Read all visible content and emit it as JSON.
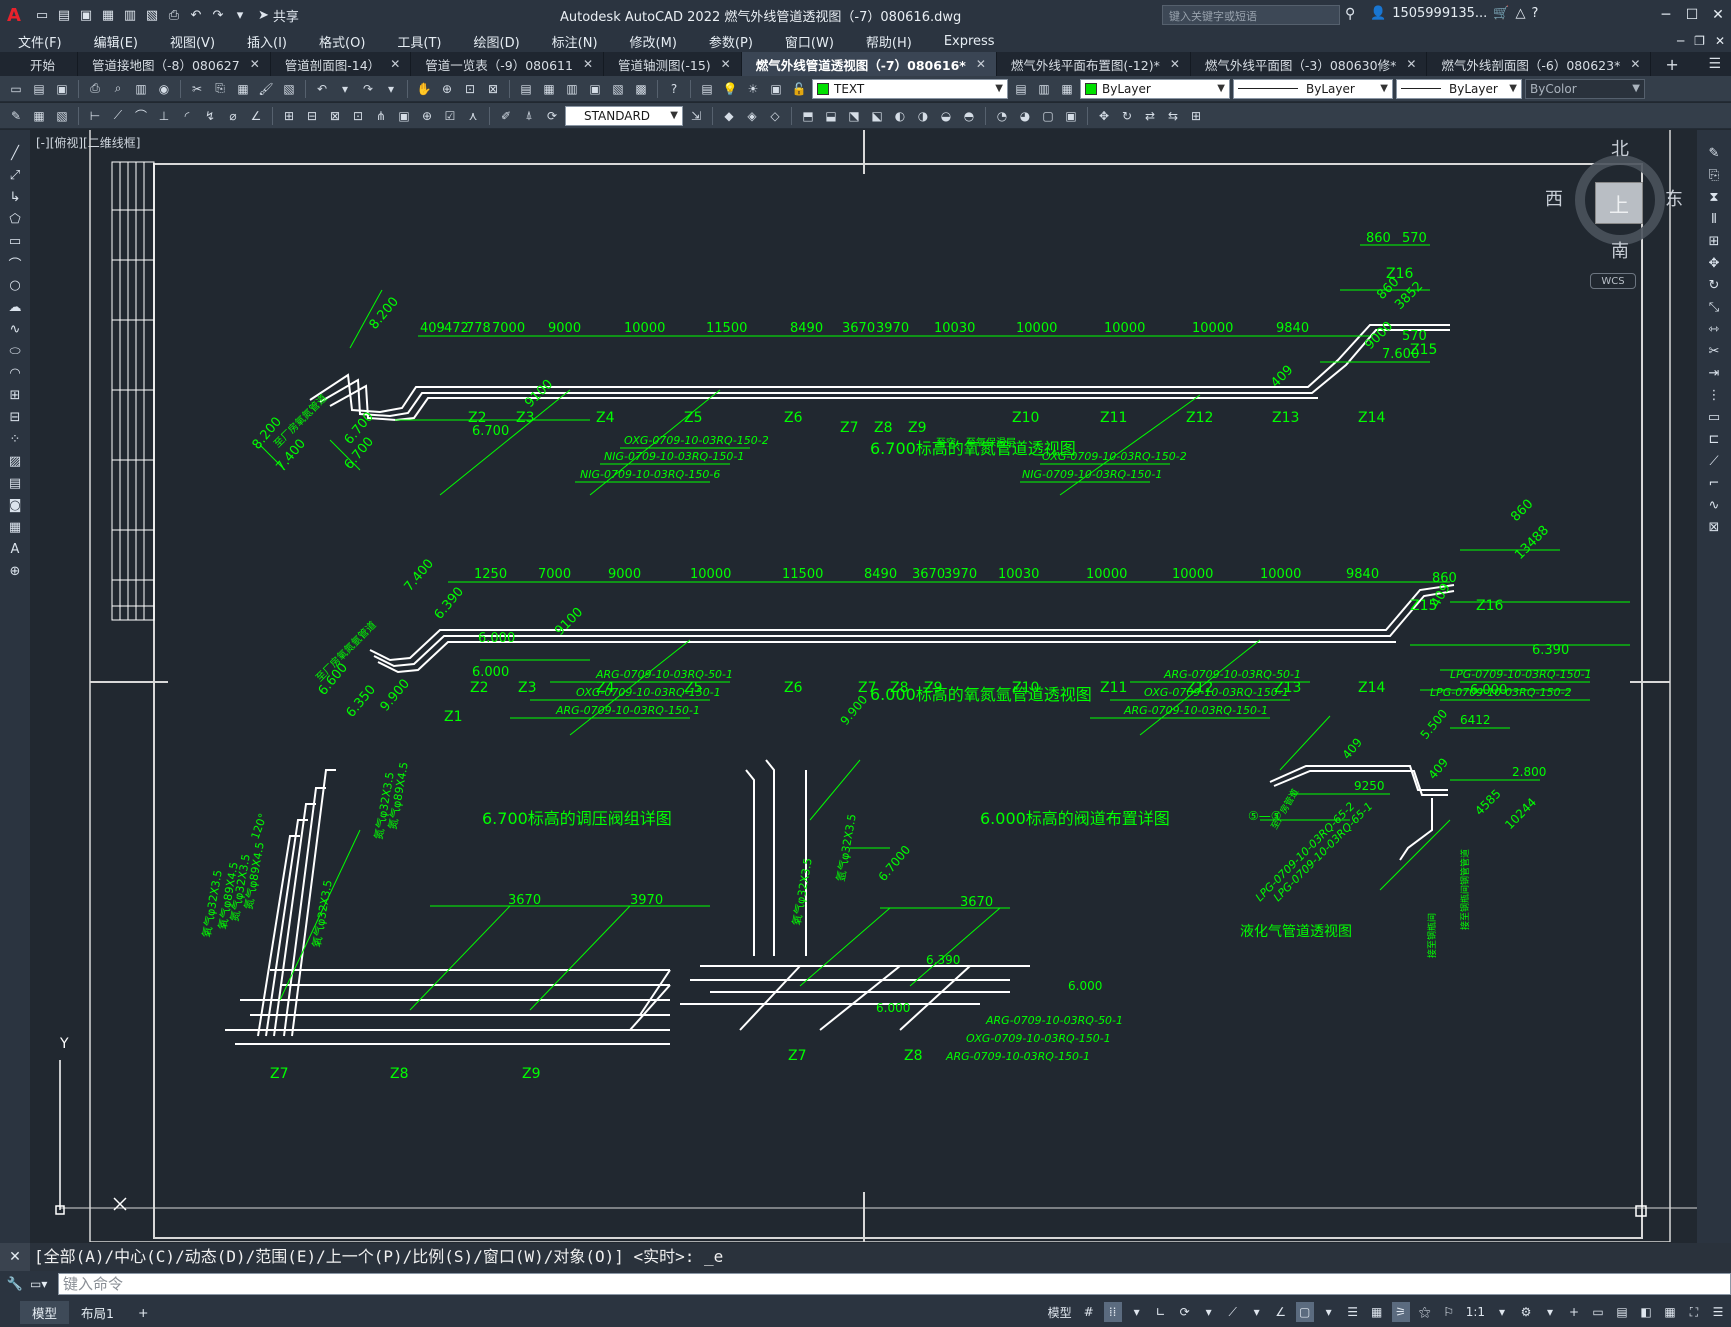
{
  "app": {
    "logo": "A",
    "title": "Autodesk AutoCAD 2022    燃气外线管道透视图（-7）080616.dwg",
    "share_label": "共享",
    "search_placeholder": "键入关键字或短语",
    "user_name": "1505999135...",
    "window_controls": [
      "─",
      "☐",
      "✕"
    ]
  },
  "menu": [
    "文件(F)",
    "编辑(E)",
    "视图(V)",
    "插入(I)",
    "格式(O)",
    "工具(T)",
    "绘图(D)",
    "标注(N)",
    "修改(M)",
    "参数(P)",
    "窗口(W)",
    "帮助(H)",
    "Express"
  ],
  "tabs": {
    "start": "开始",
    "files": [
      {
        "label": "管道接地图（-8）080627",
        "active": false
      },
      {
        "label": "管道剖面图-14）",
        "active": false
      },
      {
        "label": "管道一览表（-9）080611",
        "active": false
      },
      {
        "label": "管道轴测图(-15)",
        "active": false
      },
      {
        "label": "燃气外线管道透视图（-7）080616*",
        "active": true
      },
      {
        "label": "燃气外线平面布置图(-12)*",
        "active": false
      },
      {
        "label": "燃气外线平面图（-3）080630修*",
        "active": false
      },
      {
        "label": "燃气外线剖面图（-6）080623*",
        "active": false
      }
    ]
  },
  "properties_bar": {
    "layer": "TEXT",
    "color": "ByLayer",
    "linetype": "ByLayer",
    "lineweight": "ByLayer",
    "plotstyle": "ByColor",
    "text_style": "STANDARD"
  },
  "viewport": {
    "label": "[-][俯视][二维线框]"
  },
  "viewcube": {
    "north": "北",
    "south": "南",
    "east": "东",
    "west": "西",
    "face": "上",
    "wcs": "WCS"
  },
  "drawing": {
    "title_top": "6.700标高的氧氮管道透视图",
    "title_mid": "6.000标高的氧氮氩管道透视图",
    "title_left_detail": "6.700标高的调压阀组详图",
    "title_right_detail": "6.000标高的阀道布置详图",
    "title_lpg": "液化气管道透视图",
    "top_dims": [
      "409",
      "472",
      "778",
      "7000",
      "9000",
      "10000",
      "11500",
      "8490",
      "3670",
      "3970",
      "10030",
      "10000",
      "10000",
      "10000",
      "9840"
    ],
    "top_labels": [
      "Z2",
      "Z3",
      "Z4",
      "Z5",
      "Z6",
      "Z7",
      "Z8",
      "Z9",
      "Z10",
      "Z11",
      "Z12",
      "Z13",
      "Z14",
      "Z15",
      "Z16"
    ],
    "top_right_dims": [
      "860",
      "570",
      "570",
      "860",
      "3852",
      "9000",
      "409"
    ],
    "top_elevs": [
      "8.200",
      "6.700",
      "8.200",
      "7.400",
      "6.700",
      "6.700",
      "7.600"
    ],
    "top_misc": [
      "9100",
      "至厂房氧氮管道",
      "至空、至氧保温层"
    ],
    "top_pipe_codes_left": [
      "OXG-0709-10-03RQ-150-2",
      "NIG-0709-10-03RQ-150-1",
      "NIG-0709-10-03RQ-150-6"
    ],
    "top_pipe_codes_right": [
      "OXG-0709-10-03RQ-150-2",
      "NIG-0709-10-03RQ-150-1"
    ],
    "mid_dims": [
      "1250",
      "7000",
      "9000",
      "10000",
      "11500",
      "8490",
      "3670",
      "3970",
      "10030",
      "10000",
      "10000",
      "10000",
      "9840"
    ],
    "mid_labels": [
      "Z1",
      "Z2",
      "Z3",
      "Z4",
      "Z5",
      "Z6",
      "Z7",
      "Z8",
      "Z9",
      "Z10",
      "Z11",
      "Z12",
      "Z13",
      "Z14",
      "Z15",
      "Z16"
    ],
    "mid_right_dims": [
      "860",
      "860",
      "13488",
      "409"
    ],
    "mid_elevs": [
      "7.400",
      "6.390",
      "6.000",
      "6.000",
      "6.600",
      "6.350",
      "9.900",
      "6.390",
      "6.000"
    ],
    "mid_misc": [
      "9100",
      "至厂房氧氮氩管道"
    ],
    "mid_pipe_codes_left": [
      "ARG-0709-10-03RQ-50-1",
      "OXG-0709-10-03RQ-150-1",
      "ARG-0709-10-03RQ-150-1"
    ],
    "mid_pipe_codes_right": [
      "ARG-0709-10-03RQ-50-1",
      "OXG-0709-10-03RQ-150-1",
      "ARG-0709-10-03RQ-150-1"
    ],
    "lpg_pipe_codes": [
      "LPG-0709-10-03RQ-150-1",
      "LPG-0709-10-03RQ-150-2"
    ],
    "lpg_dims": [
      "409",
      "5.500",
      "6412",
      "9250",
      "409",
      "2.800",
      "4585",
      "10244"
    ],
    "lpg_misc": [
      "至厂房管道",
      "⑤—⑤",
      "LPG-0709-10-03RQ-65-2",
      "LPG-0709-10-03RQ-65-1",
      "接至钢瓶间",
      "接至钢瓶间钢管管道"
    ],
    "left_detail_dims": [
      "3670",
      "3970",
      "120°"
    ],
    "left_detail_labels": [
      "Z7",
      "Z8",
      "Z9"
    ],
    "left_detail_pipes": [
      "氧气φ32X3.5",
      "氧气φ89X4.5",
      "氮气φ32X3.5",
      "氮气φ89X4.5",
      "氮气φ32X3.5",
      "氮气φ89X4.5",
      "氧气φ32X3.5"
    ],
    "right_detail_dims": [
      "3670",
      "6.7000",
      "9.900",
      "6.390",
      "6.000",
      "6.000"
    ],
    "right_detail_labels": [
      "Z7",
      "Z8"
    ],
    "right_detail_pipes": [
      "氧气φ32X3.5",
      "氩气φ32X3.5"
    ],
    "right_detail_codes": [
      "ARG-0709-10-03RQ-50-1",
      "OXG-0709-10-03RQ-150-1",
      "ARG-0709-10-03RQ-150-1"
    ],
    "ucs_y": "Y"
  },
  "command": {
    "history": "[全部(A)/中心(C)/动态(D)/范围(E)/上一个(P)/比例(S)/窗口(W)/对象(O)] <实时>: _e",
    "placeholder": "键入命令"
  },
  "status": {
    "model_tab": "模型",
    "layout_tab": "布局1",
    "add_tab": "+",
    "model_btn": "模型",
    "scale": "1:1"
  },
  "colors": {
    "drawing_green": "#00ff00",
    "pipe_white": "#ffffff",
    "background": "#212830"
  }
}
